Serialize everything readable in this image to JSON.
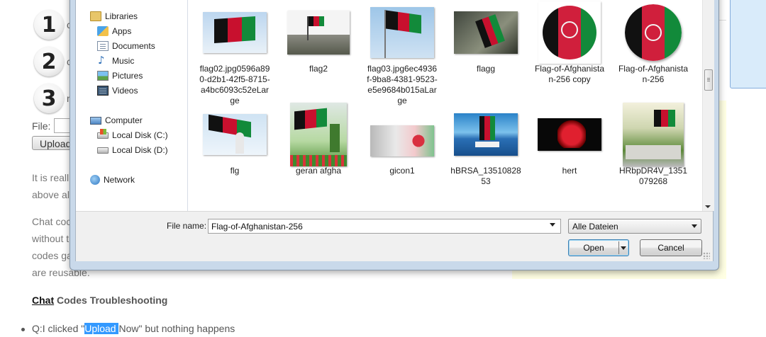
{
  "background_page": {
    "steps": [
      {
        "number": "1",
        "trail": "c"
      },
      {
        "number": "2",
        "trail": "c"
      },
      {
        "number": "3",
        "trail": "n"
      }
    ],
    "file_label": "File:",
    "upload_button": "Upload",
    "paragraph1": [
      "It is reall",
      "above al"
    ],
    "paragraph2": [
      "Chat coc",
      "without t",
      "codes ga",
      "are reusable."
    ],
    "troubleshooting": {
      "link": "Chat",
      "rest": " Codes Troubleshooting"
    },
    "bullet": {
      "prefix": "Q:I clicked \"",
      "highlight": "Upload ",
      "suffix": "Now\" but nothing happens"
    }
  },
  "dialog": {
    "nav": {
      "libraries": {
        "label": "Libraries",
        "icon": "library-icon"
      },
      "library_items": [
        {
          "label": "Apps",
          "icon": "apps-icon"
        },
        {
          "label": "Documents",
          "icon": "documents-icon"
        },
        {
          "label": "Music",
          "icon": "music-icon"
        },
        {
          "label": "Pictures",
          "icon": "pictures-icon"
        },
        {
          "label": "Videos",
          "icon": "videos-icon"
        }
      ],
      "computer": {
        "label": "Computer",
        "icon": "computer-icon"
      },
      "drives": [
        {
          "label": "Local Disk (C:)",
          "icon": "windows-drive-icon"
        },
        {
          "label": "Local Disk (D:)",
          "icon": "drive-icon"
        }
      ],
      "network": {
        "label": "Network",
        "icon": "network-icon"
      }
    },
    "files": [
      {
        "name": "flag02.jpg0596a890-d2b1-42f5-8715-a4bc6093c52eLarge"
      },
      {
        "name": "flag2"
      },
      {
        "name": "flag03.jpg6ec4936f-9ba8-4381-9523-e5e9684b015aLarge"
      },
      {
        "name": "flagg"
      },
      {
        "name": "Flag-of-Afghanistan-256 copy"
      },
      {
        "name": "Flag-of-Afghanistan-256",
        "selected": true
      },
      {
        "name": "flg"
      },
      {
        "name": "geran afgha"
      },
      {
        "name": "gicon1"
      },
      {
        "name": "hBRSA_1351082853"
      },
      {
        "name": "hert"
      },
      {
        "name": "HRbpDR4V_1351079268"
      }
    ],
    "file_name_label": "File name:",
    "file_name_value": "Flag-of-Afghanistan-256",
    "file_type": "Alle Dateien",
    "open_button": "Open",
    "cancel_button": "Cancel"
  },
  "colors": {
    "flag_black": "#111111",
    "flag_red": "#c8102e",
    "flag_green": "#128a3a",
    "selection": "#d9ebfa"
  }
}
